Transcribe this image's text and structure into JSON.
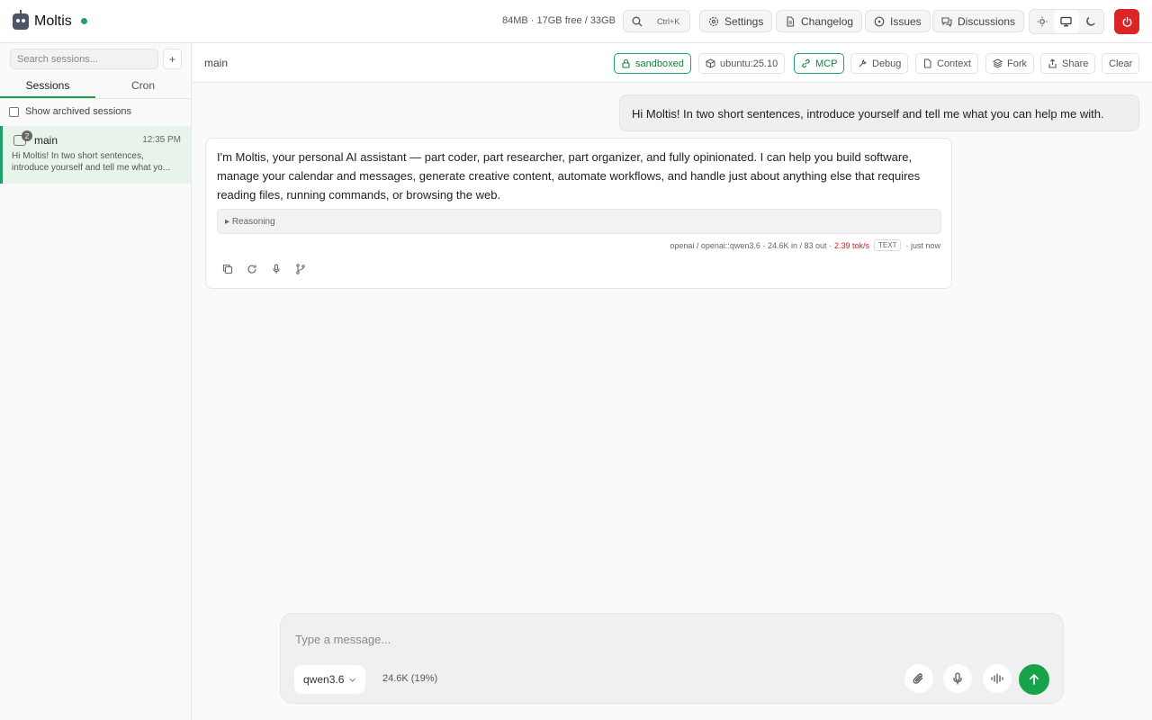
{
  "app": {
    "name": "Moltis",
    "status_color": "#22a06b"
  },
  "header": {
    "stats": "84MB · 17GB free / 33GB",
    "search_shortcut": "Ctrl+K",
    "settings_label": "Settings",
    "changelog_label": "Changelog",
    "issues_label": "Issues",
    "discussions_label": "Discussions",
    "theme_options": [
      "light-icon",
      "monitor-icon",
      "moon-icon"
    ],
    "active_theme": "system"
  },
  "sidebar": {
    "search_placeholder": "Search sessions...",
    "add_label": "+",
    "tabs": [
      "Sessions",
      "Cron"
    ],
    "show_archived_label": "Show archived sessions",
    "sessions": [
      {
        "name": "main",
        "time": "12:35 PM",
        "badge": "2",
        "preview": "Hi Moltis! In two short sentences, introduce yourself and tell me what yo..."
      }
    ]
  },
  "main": {
    "title": "main",
    "buttons": {
      "sandboxed": "sandboxed",
      "image": "ubuntu:25.10",
      "mcp": "MCP",
      "debug": "Debug",
      "context": "Context",
      "fork": "Fork",
      "share": "Share",
      "clear": "Clear"
    },
    "user_message": "Hi Moltis! In two short sentences, introduce yourself and tell me what you can help me with.",
    "assistant_message": "I'm Moltis, your personal AI assistant — part coder, part researcher, part organizer, and fully opinionated. I can help you build software, manage your calendar and messages, generate creative content, automate workflows, and handle just about anything else that requires reading files, running commands, or browsing the web.",
    "reasoning_label": "Reasoning",
    "meta": {
      "model": "openai / openai::qwen3.6 · 24.6K in / 83 out ·",
      "rate": "2.39 tok/s",
      "tag": "TEXT",
      "time": "· just now"
    }
  },
  "composer": {
    "placeholder": "Type a message...",
    "model": "qwen3.6",
    "context_usage": "24.6K (19%)",
    "accent": "#16a34a"
  }
}
